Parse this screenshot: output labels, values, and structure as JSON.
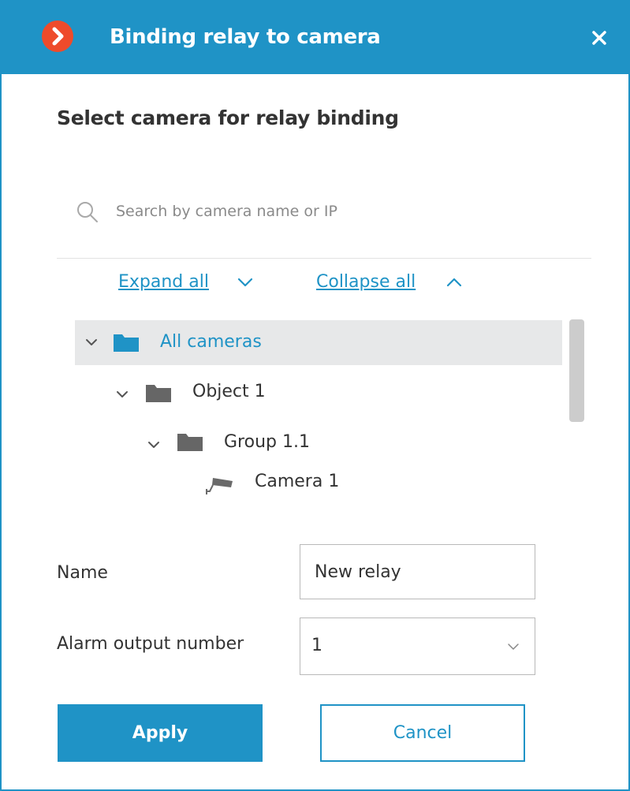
{
  "window": {
    "title": "Binding relay to camera",
    "accent_color": "#1f93c6",
    "logo_color": "#ee4b2b",
    "logo_icon": "chevron-right-icon",
    "close_icon": "close-icon"
  },
  "dialog": {
    "subtitle": "Select camera for relay binding"
  },
  "search": {
    "value": "",
    "placeholder": "Search by camera name or IP",
    "icon": "search-icon"
  },
  "tree_controls": {
    "expand_all": "Expand all",
    "collapse_all": "Collapse all"
  },
  "tree": {
    "items": [
      {
        "label": "All cameras",
        "type": "folder",
        "expanded": true,
        "selected": true,
        "depth": 0
      },
      {
        "label": "Object 1",
        "type": "folder",
        "expanded": true,
        "selected": false,
        "depth": 1
      },
      {
        "label": "Group 1.1",
        "type": "folder",
        "expanded": true,
        "selected": false,
        "depth": 2
      },
      {
        "label": "Camera 1",
        "type": "camera",
        "expanded": false,
        "selected": false,
        "depth": 3
      }
    ]
  },
  "form": {
    "name_label": "Name",
    "name_value": "New relay",
    "alarm_output_label": "Alarm output number",
    "alarm_output_value": "1"
  },
  "buttons": {
    "apply": "Apply",
    "cancel": "Cancel"
  }
}
